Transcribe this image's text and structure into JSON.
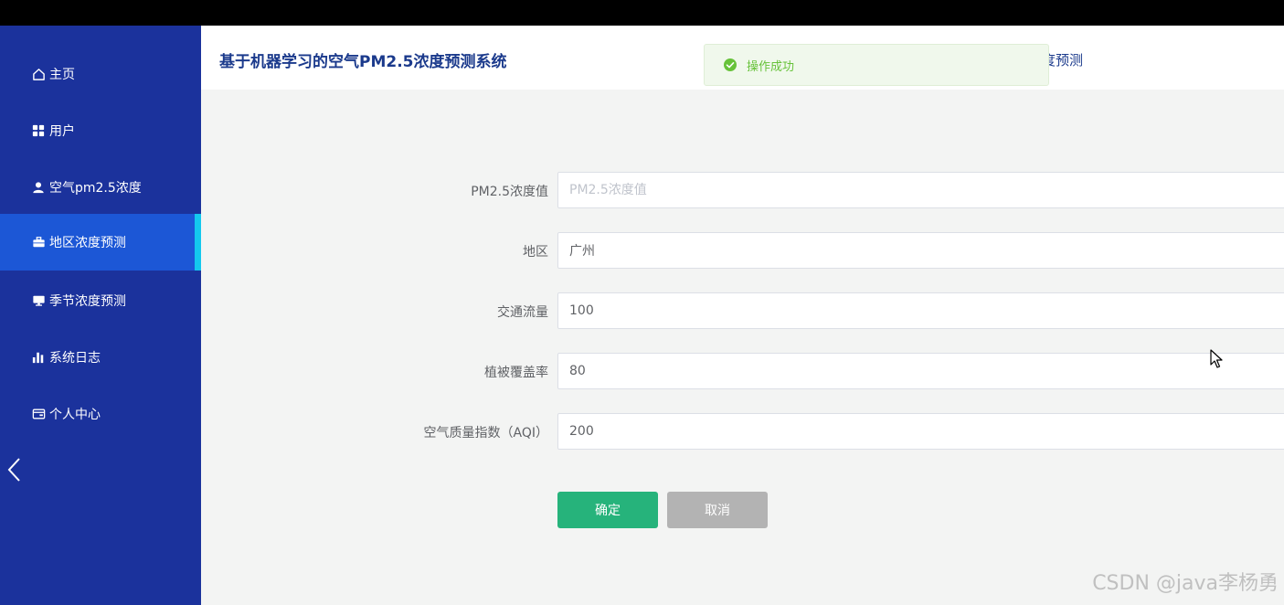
{
  "header": {
    "system_title": "基于机器学习的空气PM2.5浓度预测系统",
    "tab_partial": "度预测"
  },
  "sidebar": {
    "items": [
      {
        "label": "主页",
        "icon": "home-icon"
      },
      {
        "label": "用户",
        "icon": "grid-icon"
      },
      {
        "label": "空气pm2.5浓度",
        "icon": "user-icon"
      },
      {
        "label": "地区浓度预测",
        "icon": "briefcase-icon",
        "active": true
      },
      {
        "label": "季节浓度预测",
        "icon": "monitor-icon"
      },
      {
        "label": "系统日志",
        "icon": "bar-chart-icon"
      },
      {
        "label": "个人中心",
        "icon": "wallet-icon"
      }
    ]
  },
  "toast": {
    "message": "操作成功",
    "color": "#67c23a"
  },
  "form": {
    "fields": [
      {
        "label": "PM2.5浓度值",
        "value": "",
        "placeholder": "PM2.5浓度值"
      },
      {
        "label": "地区",
        "value": "广州"
      },
      {
        "label": "交通流量",
        "value": "100"
      },
      {
        "label": "植被覆盖率",
        "value": "80"
      },
      {
        "label": "空气质量指数（AQI）",
        "value": "200"
      }
    ],
    "confirm_label": "确定",
    "cancel_label": "取消"
  },
  "watermark": "CSDN @java李杨勇",
  "colors": {
    "sidebar_bg": "#1b329c",
    "sidebar_active": "#1c57d6",
    "active_indicator": "#14c8ee",
    "confirm_button": "#26b37b",
    "cancel_button": "#b3b3b3"
  }
}
